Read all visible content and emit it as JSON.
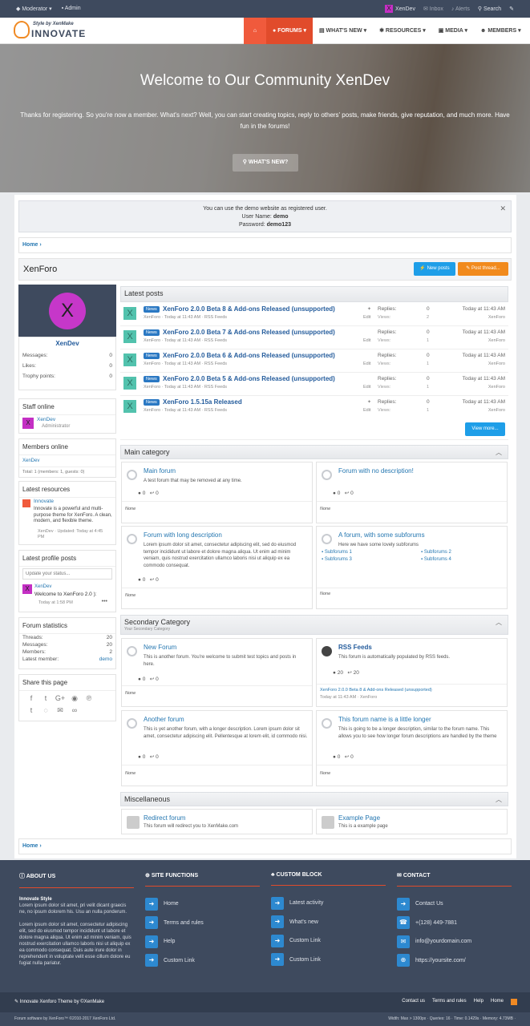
{
  "topbar": {
    "moderator": "Moderator ▾",
    "admin": "Admin",
    "user": "XenDev",
    "inbox": "Inbox",
    "alerts": "Alerts",
    "search": "Search"
  },
  "logo": {
    "tagline": "Style by XenMake",
    "name": "INNOVATE"
  },
  "nav": {
    "forums": "FORUMS ▾",
    "whats_new": "WHAT'S NEW ▾",
    "resources": "RESOURCES ▾",
    "media": "MEDIA ▾",
    "members": "MEMBERS ▾"
  },
  "hero": {
    "title": "Welcome to Our Community XenDev",
    "text": "Thanks for registering. So you're now a member. What's next? Well, you can start creating topics, reply to others' posts, make friends, give reputation, and much more. Have fun in the forums!",
    "button": "WHAT'S NEW?"
  },
  "notice": {
    "line1": "You can use the demo website as registered user.",
    "user_label": "User Name:",
    "user": "demo",
    "pass_label": "Password:",
    "pass": "demo123"
  },
  "breadcrumb": "Home",
  "page": {
    "title": "XenForo",
    "new_posts": "New posts",
    "post_thread": "Post thread..."
  },
  "profile": {
    "initial": "X",
    "name": "XenDev",
    "stats": [
      {
        "k": "Messages:",
        "v": "0"
      },
      {
        "k": "Likes:",
        "v": "0"
      },
      {
        "k": "Trophy points:",
        "v": "0"
      }
    ]
  },
  "staff": {
    "title": "Staff online",
    "name": "XenDev",
    "role": "Administrator"
  },
  "members_online": {
    "title": "Members online",
    "name": "XenDev",
    "total": "Total: 1 (members: 1, guests: 0)"
  },
  "resources": {
    "title": "Latest resources",
    "name": "Innovate",
    "desc": "Innovate is a powerful and multi-purpose theme for XenForo. A clean, modern, and flexible theme.",
    "meta": "XenDev · Updated: Today at 4:45 PM"
  },
  "profile_posts": {
    "title": "Latest profile posts",
    "placeholder": "Update your status...",
    "name": "XenDev",
    "text": "Welcome to XenForo 2.0 ):",
    "time": "Today at 1:58 PM"
  },
  "forum_stats": {
    "title": "Forum statistics",
    "rows": [
      {
        "k": "Threads:",
        "v": "20"
      },
      {
        "k": "Messages:",
        "v": "20"
      },
      {
        "k": "Members:",
        "v": "2"
      },
      {
        "k": "Latest member:",
        "v": "demo"
      }
    ]
  },
  "share": {
    "title": "Share this page"
  },
  "latest": {
    "title": "Latest posts",
    "view_more": "View more...",
    "posts": [
      {
        "badge": "News",
        "title": "XenForo 2.0.0 Beta 8 & Add-ons Released (unsupported)",
        "meta": "XenForo · Today at 11:43 AM · RSS Feeds",
        "edit": "Edit",
        "replies_label": "Replies:",
        "views_label": "Views:",
        "replies": "0",
        "views": "2",
        "date": "Today at 11:43 AM",
        "by": "XenForo",
        "pinned": true
      },
      {
        "badge": "News",
        "title": "XenForo 2.0.0 Beta 7 & Add-ons Released (unsupported)",
        "meta": "XenForo · Today at 11:43 AM · RSS Feeds",
        "edit": "Edit",
        "replies_label": "Replies:",
        "views_label": "Views:",
        "replies": "0",
        "views": "1",
        "date": "Today at 11:43 AM",
        "by": "XenForo",
        "pinned": false
      },
      {
        "badge": "News",
        "title": "XenForo 2.0.0 Beta 6 & Add-ons Released (unsupported)",
        "meta": "XenForo · Today at 11:43 AM · RSS Feeds",
        "edit": "Edit",
        "replies_label": "Replies:",
        "views_label": "Views:",
        "replies": "0",
        "views": "1",
        "date": "Today at 11:43 AM",
        "by": "XenForo",
        "pinned": false
      },
      {
        "badge": "News",
        "title": "XenForo 2.0.0 Beta 5 & Add-ons Released (unsupported)",
        "meta": "XenForo · Today at 11:43 AM · RSS Feeds",
        "edit": "Edit",
        "replies_label": "Replies:",
        "views_label": "Views:",
        "replies": "0",
        "views": "1",
        "date": "Today at 11:43 AM",
        "by": "XenForo",
        "pinned": false
      },
      {
        "badge": "News",
        "title": "XenForo 1.5.15a Released",
        "meta": "XenForo · Today at 11:43 AM · RSS Feeds",
        "edit": "Edit",
        "replies_label": "Replies:",
        "views_label": "Views:",
        "replies": "0",
        "views": "1",
        "date": "Today at 11:43 AM",
        "by": "XenForo",
        "pinned": true
      }
    ]
  },
  "main_cat": {
    "title": "Main category",
    "f1": {
      "name": "Main forum",
      "desc": "A test forum that may be removed at any time.",
      "threads": "0",
      "msgs": "0",
      "none": "None"
    },
    "f2": {
      "name": "Forum with no description!",
      "threads": "0",
      "msgs": "0",
      "none": "None"
    },
    "f3": {
      "name": "Forum with long description",
      "desc": "Lorem ipsum dolor sit amet, consectetur adipiscing elit, sed do eiusmod tempor incididunt ut labore et dolore magna aliqua. Ut enim ad minim veniam, quis nostrud exercitation ullamco laboris nisi ut aliquip ex ea commodo consequat.",
      "threads": "0",
      "msgs": "0",
      "none": "None"
    },
    "f4": {
      "name": "A forum, with some subforums",
      "desc": "Here we have some lovely subforums",
      "subs": [
        "Subforums 1",
        "Subforums 2",
        "Subforums 3",
        "Subforums 4"
      ],
      "none": "None"
    }
  },
  "sec_cat": {
    "title": "Secondary Category",
    "subtitle": "Your Secondary Category",
    "f1": {
      "name": "New Forum",
      "desc": "This is another forum. You're welcome to submit test topics and posts in here.",
      "threads": "0",
      "msgs": "0",
      "none": "None"
    },
    "f2": {
      "name": "RSS Feeds",
      "desc": "This forum is automatically populated by RSS feeds.",
      "threads": "20",
      "msgs": "20",
      "last": "XenForo 2.0.0 Beta 8 & Add-ons Released (unsupported)",
      "last_meta": "Today at 11:43 AM · XenForo"
    },
    "f3": {
      "name": "Another forum",
      "desc": "This is yet another forum, with a longer description. Lorem ipsum dolor sit amet, consectetur adipiscing elit. Pellentesque at lorem elit, id commodo nisi.",
      "threads": "0",
      "msgs": "0",
      "none": "None"
    },
    "f4": {
      "name": "This forum name is a little longer",
      "desc": "This is going to be a longer description, similar to the forum name. This allows you to see how longer forum descriptions are handled by the theme",
      "threads": "0",
      "msgs": "0",
      "none": "None"
    }
  },
  "misc": {
    "title": "Miscellaneous",
    "f1": {
      "name": "Redirect forum",
      "desc": "This forum will redirect you to XenMake.com"
    },
    "f2": {
      "name": "Example Page",
      "desc": "This is a example page"
    }
  },
  "footer": {
    "about": {
      "title": "ABOUT US",
      "head": "Innovate Style",
      "p1": "Lorem ipsum dolor sit amet, pri velit dicant graecis ne, no ipsum dolorem his. Usu an nulla ponderum.",
      "p2": "Lorem ipsum dolor sit amet, consectetur adipiscing elit, sed do eiusmod tempor incididunt ut labore et dolore magna aliqua. Ut enim ad minim veniam, quis nostrud exercitation ullamco laboris nisi ut aliquip ex ea commodo consequat. Duis aute irure dolor in reprehenderit in voluptate velit esse cillum dolore eu fugiat nulla pariatur."
    },
    "site": {
      "title": "SITE FUNCTIONS",
      "links": [
        "Home",
        "Terms and rules",
        "Help",
        "Custom Link"
      ]
    },
    "custom": {
      "title": "CUSTOM BLOCK",
      "links": [
        "Latest activity",
        "What's new",
        "Custom Link",
        "Custom Link"
      ]
    },
    "contact": {
      "title": "CONTACT",
      "links": [
        "Contact Us",
        "+(128) 449-7881",
        "info@yourdomain.com",
        "https://yoursite.com/"
      ]
    }
  },
  "bottom": {
    "left": "Innovate  Xenforo Theme  by  ©XenMake",
    "links": [
      "Contact us",
      "Terms and rules",
      "Help",
      "Home"
    ]
  },
  "copyright": {
    "left": "Forum software by XenForo™ ©2010-2017 XenForo Ltd.",
    "right": "Width: Max > 1300px · Queries: 16 · Time: 0.1429s · Memory: 4.73MB ·"
  }
}
